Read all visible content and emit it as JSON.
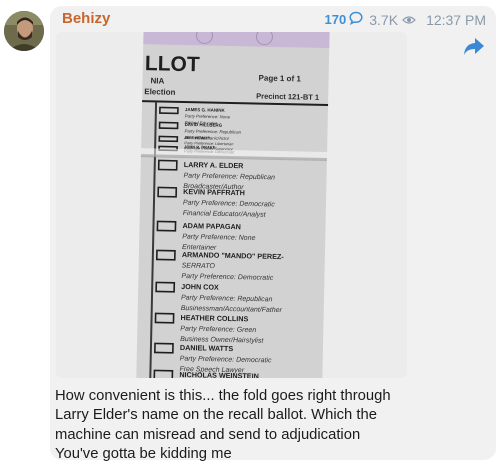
{
  "post": {
    "author": "Behizy",
    "comment_count": "170",
    "views": "3.7K",
    "time": "12:37 PM",
    "caption_lines": [
      "How convenient is this... the fold goes right through",
      "Larry Elder's name on the recall ballot. Which the",
      "machine can misread and send to adjudication",
      "You've gotta be kidding me"
    ]
  },
  "icons": {
    "comment": "speech-bubble-icon",
    "views": "eye-icon",
    "share": "share-arrow-icon"
  },
  "colors": {
    "author": "#c9662d",
    "comments": "#3e8fd6",
    "meta": "#8a9aab",
    "share": "#3b89d4",
    "ballot_header": "#c9b7d6"
  },
  "ballot": {
    "header_title": "LLOT",
    "header_sub1": "NIA",
    "header_sub2": "Election",
    "page_label": "Page 1 of 1",
    "precinct": "Precinct 121-BT 1",
    "candidates": [
      {
        "name": "JAMES G. HANINK",
        "line1": "Party Preference: None",
        "line2": "Retired Educator"
      },
      {
        "name": "DAVID HILLBERG",
        "line1": "Party Preference: Republican",
        "line2": "Aircraft Mechanic/Actor"
      },
      {
        "name": "JEFF HEWITT",
        "line1": "Party Preference: Libertarian",
        "line2": "Riverside County Supervisor"
      },
      {
        "name": "JOHN R. DRAKE",
        "line1": "Party Preference: Democratic",
        "line2": ""
      },
      {
        "name": "LARRY A. ELDER",
        "line1": "Party Preference: Republican",
        "line2": "Broadcaster/Author"
      },
      {
        "name": "KEVIN PAFFRATH",
        "line1": "Party Preference: Democratic",
        "line2": "Financial Educator/Analyst"
      },
      {
        "name": "ADAM PAPAGAN",
        "line1": "Party Preference: None",
        "line2": "Entertainer"
      },
      {
        "name": "ARMANDO \"MANDO\" PEREZ-",
        "line1": "SERRATO",
        "line2": "Party Preference: Democratic"
      },
      {
        "name": "JOHN COX",
        "line1": "Party Preference: Republican",
        "line2": "Businessman/Accountant/Father"
      },
      {
        "name": "HEATHER COLLINS",
        "line1": "Party Preference: Green",
        "line2": "Business Owner/Hairstylist"
      },
      {
        "name": "DANIEL WATTS",
        "line1": "Party Preference: Democratic",
        "line2": "Free Speech Lawyer"
      },
      {
        "name": "NICHOLAS WEINSTEIN",
        "line1": "",
        "line2": ""
      }
    ]
  }
}
